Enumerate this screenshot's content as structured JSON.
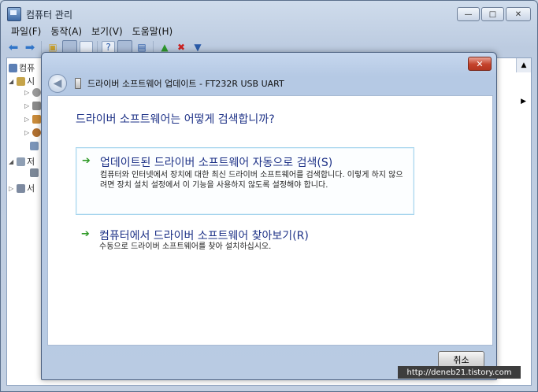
{
  "outer_window": {
    "title": "컴퓨터 관리",
    "buttons": {
      "minimize": "—",
      "maximize": "□",
      "close": "✕"
    },
    "menu": [
      "파일(F)",
      "동작(A)",
      "보기(V)",
      "도움말(H)"
    ]
  },
  "tree": {
    "items": [
      "컴퓨",
      "시",
      "저",
      "서"
    ]
  },
  "dialog": {
    "title": "드라이버 소프트웨어 업데이트 - FT232R USB UART",
    "close_label": "✕",
    "question": "드라이버 소프트웨어는 어떻게 검색합니까?",
    "options": [
      {
        "title": "업데이트된 드라이버 소프트웨어 자동으로 검색(S)",
        "description": "컴퓨터와 인터넷에서 장치에 대한 최신 드라이버 소프트웨어를 검색합니다. 이렇게 하지 않으려면 장치 설치 설정에서 이 기능을 사용하지 않도록 설정해야 합니다."
      },
      {
        "title": "컴퓨터에서 드라이버 소프트웨어 찾아보기(R)",
        "description": "수동으로 드라이버 소프트웨어를 찾아 설치하십시오."
      }
    ],
    "cancel_label": "취소"
  },
  "watermark": "http://deneb21.tistory.com",
  "colors": {
    "link_blue": "#1e3287",
    "arrow_green": "#2f9a27",
    "highlight_border": "#a9d6ee"
  }
}
